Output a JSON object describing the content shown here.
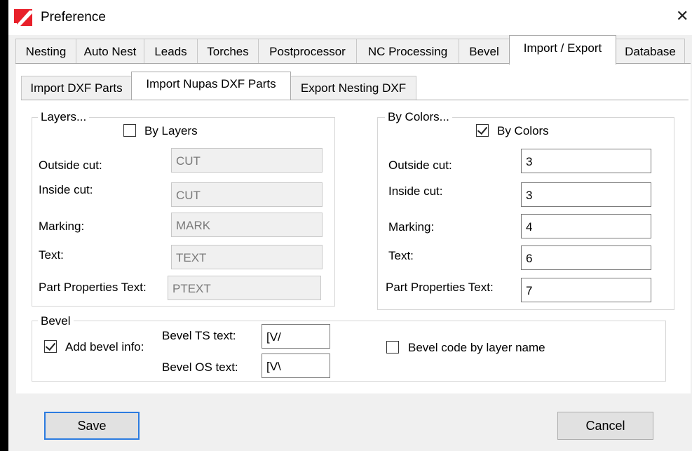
{
  "window": {
    "title": "Preference",
    "logo_icon": "app-logo-red-slash",
    "close_glyph": "✕"
  },
  "tabs": [
    {
      "label": "Nesting",
      "active": false
    },
    {
      "label": "Auto Nest",
      "active": false
    },
    {
      "label": "Leads",
      "active": false
    },
    {
      "label": "Torches",
      "active": false
    },
    {
      "label": "Postprocessor",
      "active": false
    },
    {
      "label": "NC Processing",
      "active": false
    },
    {
      "label": "Bevel",
      "active": false
    },
    {
      "label": "Import / Export",
      "active": true
    },
    {
      "label": "Database",
      "active": false
    }
  ],
  "subtabs": [
    {
      "label": "Import DXF Parts",
      "active": false
    },
    {
      "label": "Import Nupas DXF Parts",
      "active": true
    },
    {
      "label": "Export Nesting DXF",
      "active": false
    }
  ],
  "layers": {
    "legend": "Layers...",
    "by_layers_label": "By Layers",
    "by_layers_checked": false,
    "outside_cut_label": "Outside cut:",
    "outside_cut_value": "CUT",
    "inside_cut_label": "Inside cut:",
    "inside_cut_value": "CUT",
    "marking_label": "Marking:",
    "marking_value": "MARK",
    "text_label": "Text:",
    "text_value": "TEXT",
    "part_props_label": "Part Properties Text:",
    "part_props_value": "PTEXT"
  },
  "colors": {
    "legend": "By Colors...",
    "by_colors_label": "By Colors",
    "by_colors_checked": true,
    "outside_cut_label": "Outside cut:",
    "outside_cut_value": "3",
    "inside_cut_label": "Inside cut:",
    "inside_cut_value": "3",
    "marking_label": "Marking:",
    "marking_value": "4",
    "text_label": "Text:",
    "text_value": "6",
    "part_props_label": "Part Properties Text:",
    "part_props_value": "7"
  },
  "bevel": {
    "legend": "Bevel",
    "add_info_label": "Add bevel info:",
    "add_info_checked": true,
    "ts_label": "Bevel TS text:",
    "ts_value": "[V/",
    "os_label": "Bevel OS text:",
    "os_value": "[V\\",
    "by_layer_label": "Bevel code by layer name",
    "by_layer_checked": false
  },
  "buttons": {
    "save": "Save",
    "cancel": "Cancel"
  },
  "colors_palette": {
    "accent": "#2b7be0",
    "logo_red": "#e8202a",
    "panel_bg": "#ffffff",
    "window_bg": "#f0f0f0"
  }
}
